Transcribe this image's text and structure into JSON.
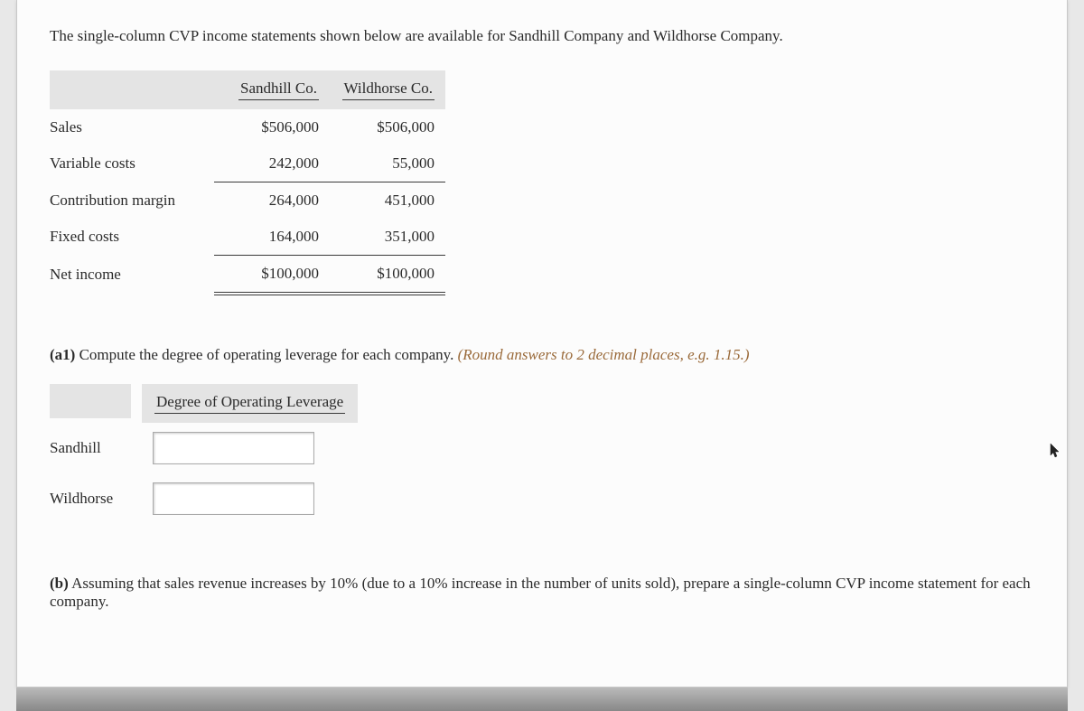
{
  "intro": "The single-column CVP income statements shown below are available for Sandhill Company and Wildhorse Company.",
  "table": {
    "headers": {
      "blank": "",
      "c1": "Sandhill Co.",
      "c2": "Wildhorse Co."
    },
    "rows": {
      "sales": {
        "label": "Sales",
        "c1": "$506,000",
        "c2": "$506,000"
      },
      "varcost": {
        "label": "Variable costs",
        "c1": "242,000",
        "c2": "55,000"
      },
      "cm": {
        "label": "Contribution margin",
        "c1": "264,000",
        "c2": "451,000"
      },
      "fixed": {
        "label": "Fixed costs",
        "c1": "164,000",
        "c2": "351,000"
      },
      "ni": {
        "label": "Net income",
        "c1": "$100,000",
        "c2": "$100,000"
      }
    }
  },
  "a1": {
    "tag": "(a1)",
    "text": " Compute the degree of operating leverage for each company. ",
    "hint": "(Round answers to 2 decimal places, e.g. 1.15.)"
  },
  "dol": {
    "header": "Degree of Operating Leverage",
    "r1": "Sandhill",
    "r2": "Wildhorse"
  },
  "b": {
    "tag": "(b)",
    "text": " Assuming that sales revenue increases by 10% (due to a 10% increase in the number of units sold), prepare a single-column CVP income statement for each company."
  }
}
